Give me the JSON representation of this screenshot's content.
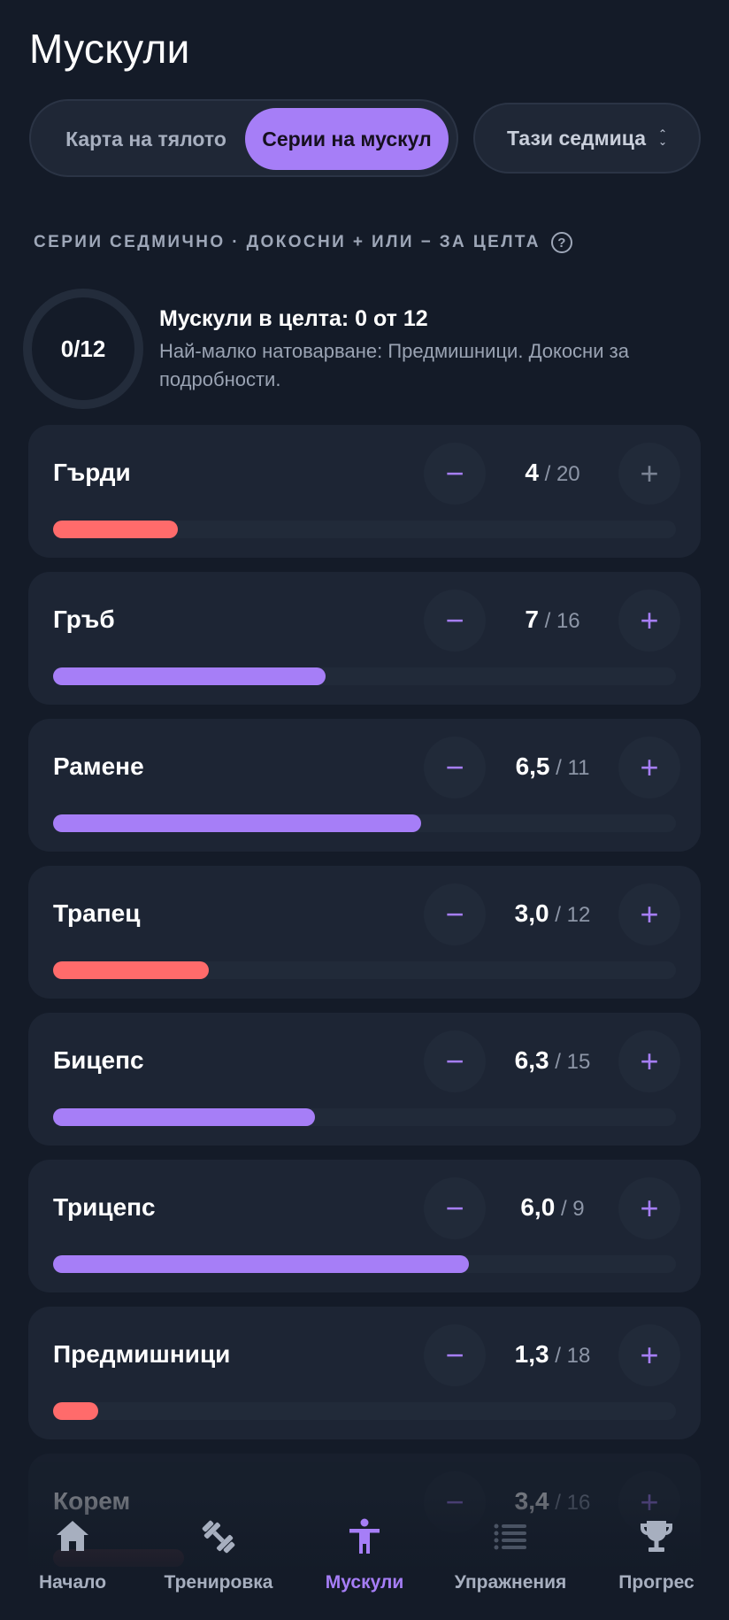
{
  "header": {
    "title": "Мускули"
  },
  "view_toggle": {
    "body_map": "Карта на тялото",
    "muscle_sets": "Серии на мускул",
    "selected": "muscle_sets"
  },
  "period": {
    "label": "Тази седмица"
  },
  "section": {
    "label": "СЕРИИ СЕДМИЧНО · ДОКОСНИ + ИЛИ − ЗА ЦЕЛТА",
    "help_glyph": "?"
  },
  "summary": {
    "ring_label": "0/12",
    "title": "Мускули в целта: 0 от 12",
    "detail": "Най-малко натоварване: Предмишници. Докосни за подробности."
  },
  "colors": {
    "accent": "#a67ef7",
    "under": "#ff6b6b",
    "background": "#141b28",
    "card": "#1d2534"
  },
  "muscles": [
    {
      "name": "Гърди",
      "current": "4",
      "target": "20",
      "progress": 0.2,
      "status": "low",
      "minus": "−",
      "plus": "+",
      "plus_disabled": true
    },
    {
      "name": "Гръб",
      "current": "7",
      "target": "16",
      "progress": 0.438,
      "status": "ok",
      "minus": "−",
      "plus": "+"
    },
    {
      "name": "Рамене",
      "current": "6,5",
      "target": "11",
      "progress": 0.591,
      "status": "ok",
      "minus": "−",
      "plus": "+"
    },
    {
      "name": "Трапец",
      "current": "3,0",
      "target": "12",
      "progress": 0.25,
      "status": "low",
      "minus": "−",
      "plus": "+"
    },
    {
      "name": "Бицепс",
      "current": "6,3",
      "target": "15",
      "progress": 0.42,
      "status": "ok",
      "minus": "−",
      "plus": "+"
    },
    {
      "name": "Трицепс",
      "current": "6,0",
      "target": "9",
      "progress": 0.667,
      "status": "ok",
      "minus": "−",
      "plus": "+"
    },
    {
      "name": "Предмишници",
      "current": "1,3",
      "target": "18",
      "progress": 0.072,
      "status": "low",
      "minus": "−",
      "plus": "+"
    },
    {
      "name": "Корем",
      "current": "3,4",
      "target": "16",
      "progress": 0.21,
      "status": "low",
      "minus": "−",
      "plus": "+"
    }
  ],
  "nav": {
    "items": [
      {
        "label": "Начало",
        "icon": "home-icon"
      },
      {
        "label": "Тренировка",
        "icon": "dumbbell-icon"
      },
      {
        "label": "Мускули",
        "icon": "person-icon",
        "active": true
      },
      {
        "label": "Упражнения",
        "icon": "list-icon"
      },
      {
        "label": "Прогрес",
        "icon": "trophy-icon"
      }
    ]
  }
}
